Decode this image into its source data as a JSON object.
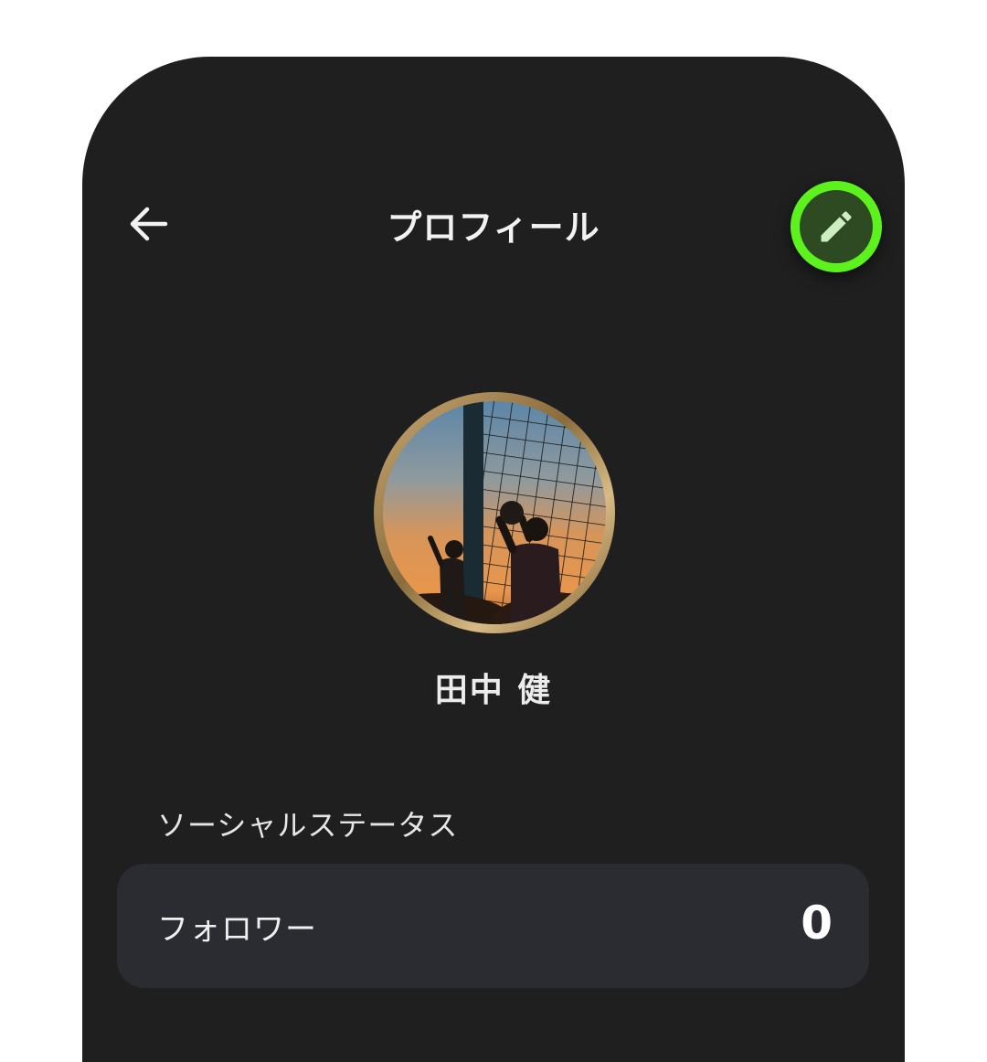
{
  "header": {
    "title": "プロフィール",
    "back_icon": "arrow-left-icon",
    "edit_icon": "pencil-icon",
    "edit_accent": "#5cf21d"
  },
  "profile": {
    "name": "田中 健",
    "avatar_description": "silhouette of goalkeeper holding ball by soccer goal net at sunset"
  },
  "social_status": {
    "section_title": "ソーシャルステータス",
    "items": [
      {
        "label": "フォロワー",
        "value": "0"
      }
    ]
  },
  "colors": {
    "background": "#1f1f1f",
    "card": "#2a2c31",
    "avatar_ring": "#b8955e"
  }
}
